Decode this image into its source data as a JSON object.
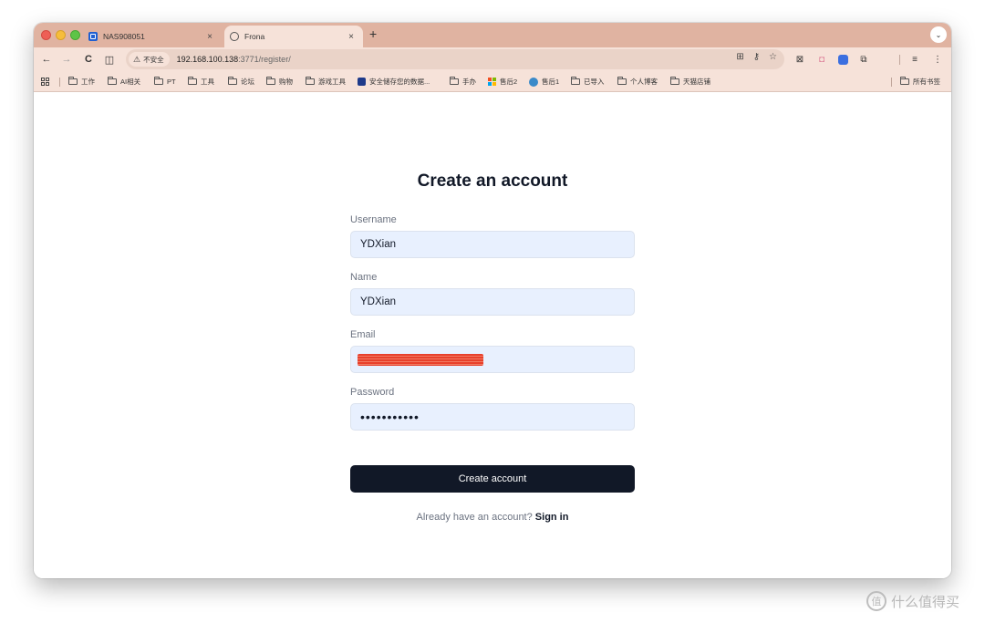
{
  "tabs": [
    {
      "title": "NAS908051",
      "close": "×"
    },
    {
      "title": "Frona",
      "close": "×"
    }
  ],
  "tab_strip": {
    "new_tab": "+",
    "menu": "⌄"
  },
  "toolbar": {
    "back": "←",
    "forward": "→",
    "reload": "C",
    "sidebar": "◫",
    "security_label": "不安全",
    "url_host": "192.168.100.138",
    "url_path": ":3771/register/"
  },
  "bookmarks": [
    {
      "label": "工作",
      "icon": "folder-icon"
    },
    {
      "label": "AI相关",
      "icon": "folder-icon"
    },
    {
      "label": "PT",
      "icon": "folder-icon"
    },
    {
      "label": "工具",
      "icon": "folder-icon"
    },
    {
      "label": "论坛",
      "icon": "folder-icon"
    },
    {
      "label": "购物",
      "icon": "folder-icon"
    },
    {
      "label": "游戏工具",
      "icon": "folder-icon"
    },
    {
      "label": "安全储存您的数据...",
      "icon": "site-icon"
    },
    {
      "label": "手办",
      "icon": "folder-icon"
    },
    {
      "label": "售后2",
      "icon": "microsoft-icon"
    },
    {
      "label": "售后1",
      "icon": "globe-icon"
    },
    {
      "label": "已导入",
      "icon": "folder-icon"
    },
    {
      "label": "个人博客",
      "icon": "folder-icon"
    },
    {
      "label": "天猫店铺",
      "icon": "folder-icon"
    }
  ],
  "all_bookmarks": "所有书签",
  "form": {
    "heading": "Create an account",
    "username_label": "Username",
    "username_value": "YDXian",
    "name_label": "Name",
    "name_value": "YDXian",
    "email_label": "Email",
    "password_label": "Password",
    "password_value": "•••••••••••",
    "submit_label": "Create account",
    "footer_text": "Already have an account?",
    "footer_link": "Sign in"
  },
  "watermark": {
    "text": "什么值得买",
    "logo": "值"
  },
  "colors": {
    "tab_strip": "#e0b3a1",
    "toolbar": "#f6e2d9",
    "input_bg": "#e8f0fe",
    "button_bg": "#111827",
    "heading": "#111827",
    "redaction": "#e8402b"
  }
}
